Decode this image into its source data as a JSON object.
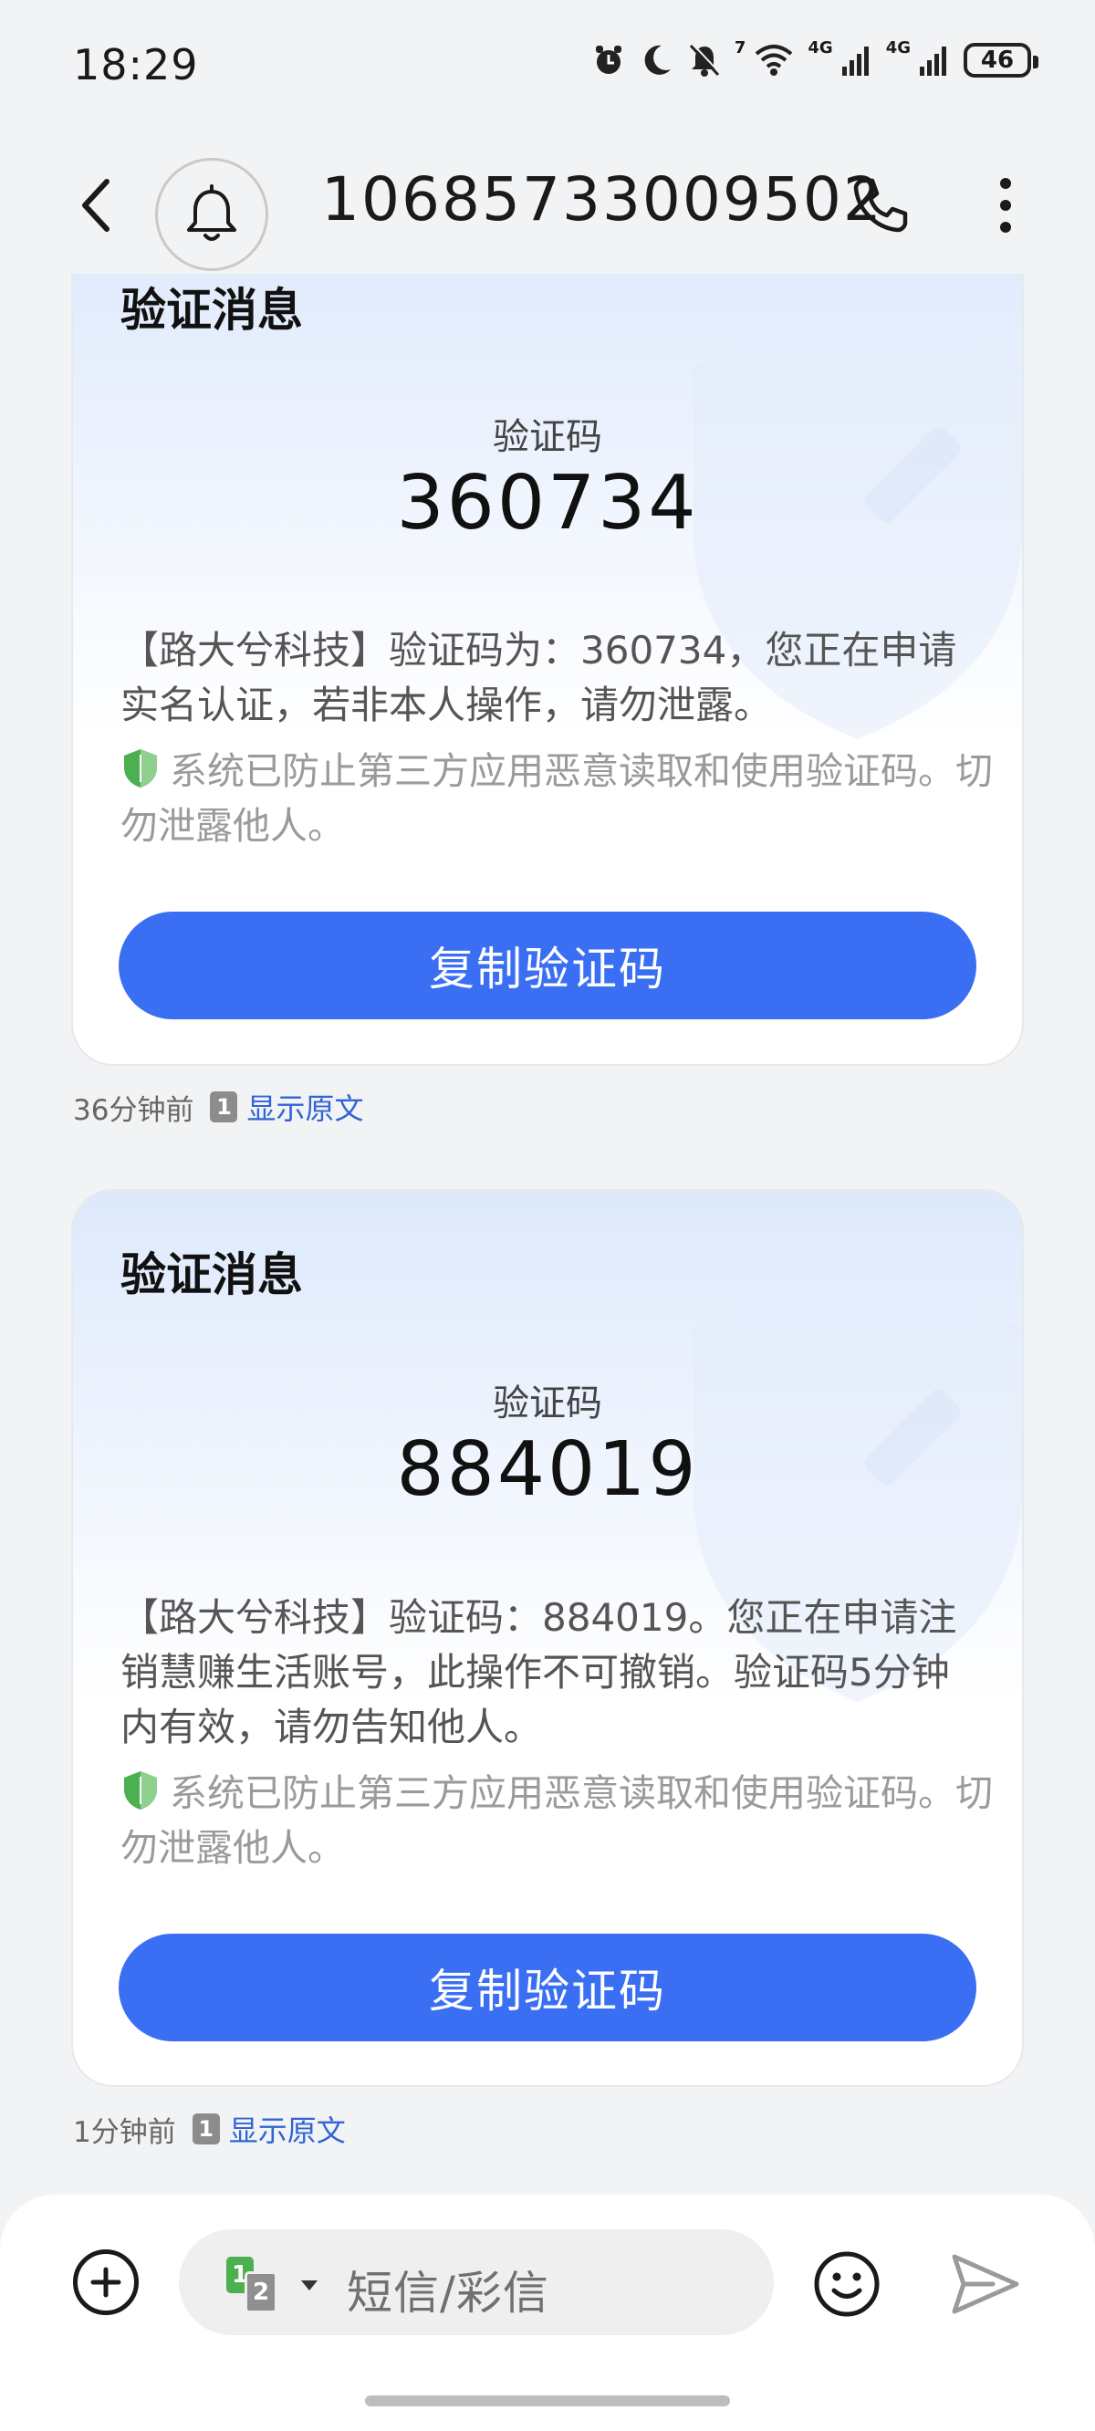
{
  "status_bar": {
    "time": "18:29",
    "network_1": "4G",
    "network_2": "4G",
    "wifi_badge": "7",
    "battery": "46"
  },
  "header": {
    "title": "10685733009502"
  },
  "messages": [
    {
      "card_title": "验证消息",
      "code_label": "验证码",
      "code": "360734",
      "body": "【路大兮科技】验证码为：360734，您正在申请实名认证，若非本人操作，请勿泄露。",
      "security_note": "系统已防止第三方应用恶意读取和使用验证码。切勿泄露他人。",
      "copy_button": "复制验证码",
      "time_ago": "36分钟前",
      "sim": "1",
      "show_original": "显示原文"
    },
    {
      "card_title": "验证消息",
      "code_label": "验证码",
      "code": "884019",
      "body": "【路大兮科技】验证码：884019。您正在申请注销慧赚生活账号，此操作不可撤销。验证码5分钟内有效，请勿告知他人。",
      "security_note": "系统已防止第三方应用恶意读取和使用验证码。切勿泄露他人。",
      "copy_button": "复制验证码",
      "time_ago": "1分钟前",
      "sim": "1",
      "show_original": "显示原文"
    }
  ],
  "composer": {
    "placeholder": "短信/彩信",
    "sim_primary": "1",
    "sim_secondary": "2"
  },
  "colors": {
    "accent": "#3a6ff3",
    "link": "#3164d6",
    "shield_green": "#4caf50"
  },
  "icons": [
    "back-icon",
    "bell-icon",
    "phone-icon",
    "more-icon",
    "shield-icon",
    "add-icon",
    "emoji-icon",
    "send-icon"
  ]
}
